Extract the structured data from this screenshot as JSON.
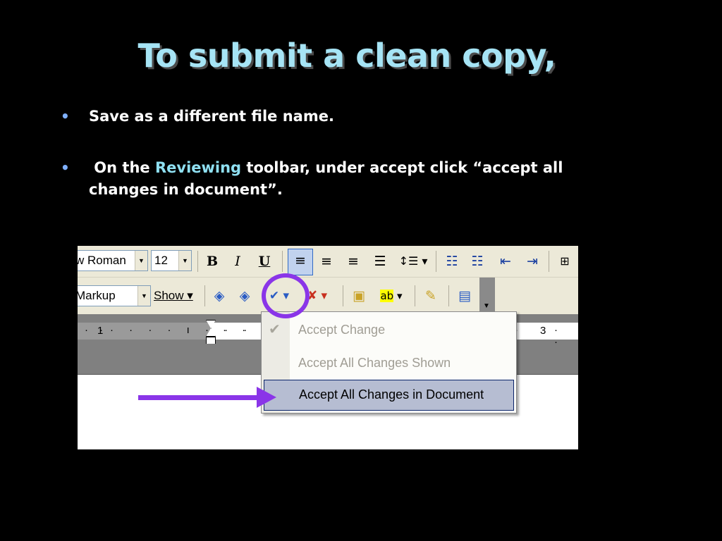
{
  "slide": {
    "title": "To submit a clean copy,",
    "bullets": [
      {
        "text": "Save as a different file name."
      },
      {
        "pre": " On the ",
        "highlight": "Reviewing",
        "post": " toolbar, under accept click “accept all changes in document”."
      }
    ],
    "bullet_char": "•"
  },
  "toolbar_formatting": {
    "font": "w Roman",
    "size": "12",
    "bold": "B",
    "italic": "I",
    "underline": "U"
  },
  "toolbar_reviewing": {
    "display_for_review": "Markup",
    "show_label": "Show ▾"
  },
  "ruler": {
    "mark_1": "1",
    "mark_3": "3"
  },
  "accept_menu": {
    "items": [
      {
        "label": "Accept Change",
        "enabled": false
      },
      {
        "label": "Accept All Changes Shown",
        "enabled": false
      },
      {
        "label": "Accept All Changes in Document",
        "enabled": true,
        "highlighted": true
      }
    ]
  },
  "colors": {
    "title": "#a6e4f5",
    "highlight": "#8fe0f2",
    "bullet_dot": "#7fb0ff",
    "annotation": "#8a35e8"
  }
}
